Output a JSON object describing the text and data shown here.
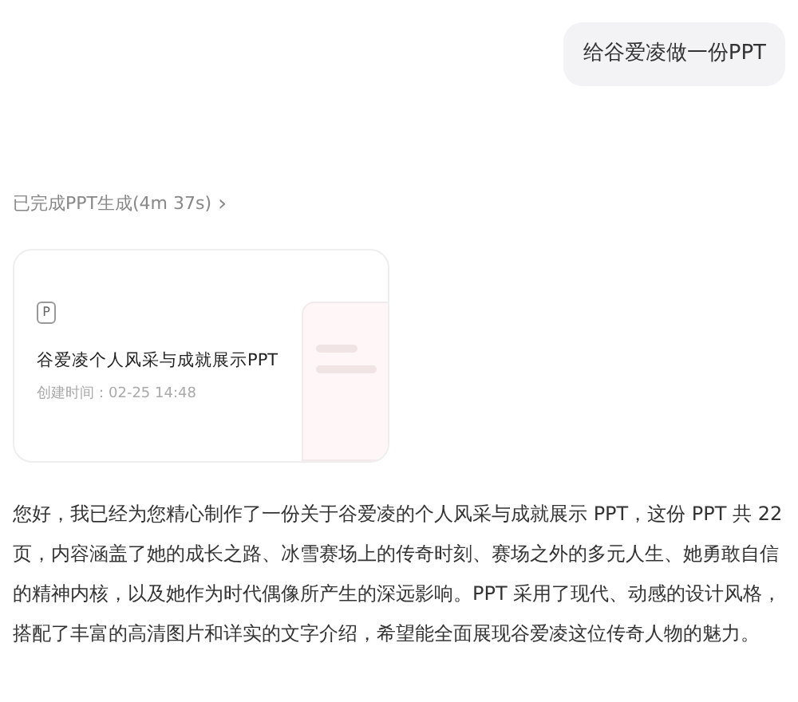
{
  "user_message": {
    "text": "给谷爱凌做一份PPT"
  },
  "status": {
    "text": "已完成PPT生成(4m 37s)",
    "chevron": "›"
  },
  "ppt_card": {
    "badge": "P",
    "title": "谷爱凌个人风采与成就展示PPT",
    "created": "创建时间：02-25 14:48"
  },
  "reply": {
    "text": "您好，我已经为您精心制作了一份关于谷爱凌的个人风采与成就展示 PPT，这份 PPT 共 22 页，内容涵盖了她的成长之路、冰雪赛场上的传奇时刻、赛场之外的多元人生、她勇敢自信的精神内核，以及她作为时代偶像所产生的深远影响。PPT 采用了现代、动感的设计风格，搭配了丰富的高清图片和详实的文字介绍，希望能全面展现谷爱凌这位传奇人物的魅力。"
  }
}
